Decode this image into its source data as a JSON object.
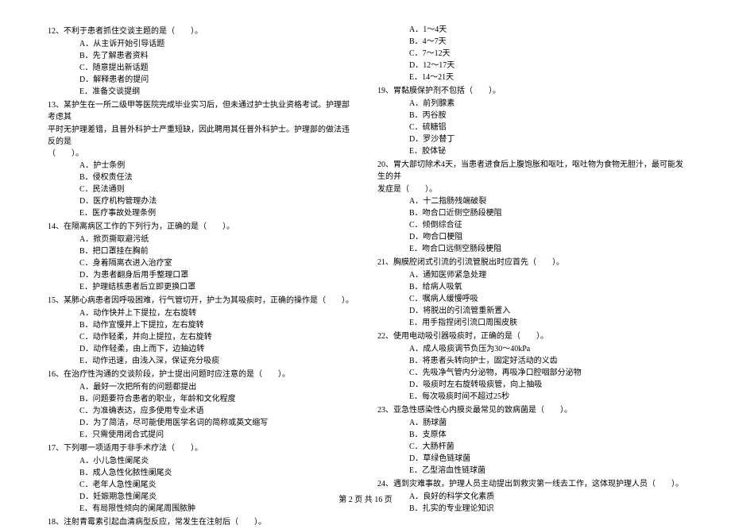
{
  "left": {
    "q12": {
      "stem": "12、不利于患者抓住交谈主题的是（　　）。",
      "A": "A．从主诉开始引导话题",
      "B": "B．先了解患者资料",
      "C": "C．随意提出新话题",
      "D": "D．解释患者的提问",
      "E": "E．准备交谈提纲"
    },
    "q13": {
      "stem1": "13、某护生在一所二级甲等医院完成毕业实习后，但未通过护士执业资格考试。护理部考虑其",
      "stem2": "平时无护理差错，且普外科护士严重短缺，因此聘用其任普外科护士。护理部的做法违反的是",
      "stem3": "（　　）。",
      "A": "A．护士条例",
      "B": "B．侵权责任法",
      "C": "C．民法通则",
      "D": "D．医疗机构管理办法",
      "E": "E．医疗事故处理条例"
    },
    "q14": {
      "stem": "14、在隔离病区工作的下列行为，正确的是（　　）。",
      "A": "A．掀页撕取避污纸",
      "B": "B．把口罩挂在胸前",
      "C": "C．身着隔离衣进入治疗室",
      "D": "D．为患者翻身后用手整理口罩",
      "E": "E．护理结核患者后立即更换口罩"
    },
    "q15": {
      "stem": "15、某肺心病患者因呼吸困难，行气管切开，护士为其吸痰时，正确的操作是（　　）。",
      "A": "A．动作快并上下提拉，左右旋转",
      "B": "B．动作宜慢并上下提拉，左右旋转",
      "C": "C．动作轻柔，并向上提拉，左右旋转",
      "D": "D．动作轻柔，由上而下，边抽边转",
      "E": "E．动作迅速，由浅入深，保证充分吸痰"
    },
    "q16": {
      "stem": "16、在治疗性沟通的交谈阶段，护士提出问题时应注意的是（　　）。",
      "A": "A．最好一次把所有的问题都提出",
      "B": "B．问题要符合患者的职业，年龄和文化程度",
      "C": "C．为准确表达，应多使用专业术语",
      "D": "D．为了简洁，尽可能使用医学名词的简称或英文缩写",
      "E": "E．只需使用闭合式提问"
    },
    "q17": {
      "stem": "17、下列哪一项适用于非手术疗法（　　）。",
      "A": "A．小儿急性阑尾炎",
      "B": "B．成人急性化脓性阑尾炎",
      "C": "C．老年人急性阑尾炎",
      "D": "D．妊娠期急性阑尾炎",
      "E": "E．有局限性倾向的阑尾周围脓肿"
    },
    "q18": {
      "stem": "18、注射青霉素引起血清病型反应，常发生在注射后（　　）。"
    }
  },
  "right": {
    "q18_options": {
      "A": "A．1～4天",
      "B": "B．4～7天",
      "C": "C．7～12天",
      "D": "D．12～17天",
      "E": "E．14～21天"
    },
    "q19": {
      "stem": "19、胃黏膜保护剂不包括（　　）。",
      "A": "A．前列腺素",
      "B": "B．丙谷胺",
      "C": "C．硫糖铝",
      "D": "D．罗沙替丁",
      "E": "E．胶体铋"
    },
    "q20": {
      "stem1": "20、胃大部切除术4天，当患者进食后上腹饱胀和呕吐，呕吐物为食物无胆汁，最可能发生的并",
      "stem2": "发症是（　　）。",
      "A": "A．十二指肠残端破裂",
      "B": "B．吻合口近侧空肠段梗阻",
      "C": "C．倾倒综合征",
      "D": "D．吻合口梗阻",
      "E": "E．吻合口远侧空肠段梗阻"
    },
    "q21": {
      "stem": "21、胸膜腔闭式引流的引流管脱出时应首先（　　）。",
      "A": "A．通知医师紧急处理",
      "B": "B．给病人吸氧",
      "C": "C．嘱病人缓慢呼吸",
      "D": "D．将脱出的引流管重新置入",
      "E": "E．用手指捏闭引流口周围皮肤"
    },
    "q22": {
      "stem": "22、使用电动吸引器吸痰时，正确的是（　　）。",
      "A": "A．成人吸痰调节负压为30～40kPa",
      "B": "B．将患者头转向护士，固定好活动的义齿",
      "C": "C．先吸净气管内分泌物，再吸净口腔咽部分泌物",
      "D": "D．吸痰时左右旋转吸痰管，向上抽吸",
      "E": "E．每次吸痰时间不超过25秒"
    },
    "q23": {
      "stem": "23、亚急性感染性心内膜炎最常见的致病菌是（　　）。",
      "A": "A．肠球菌",
      "B": "B．支原体",
      "C": "C．大肠杆菌",
      "D": "D．草绿色链球菌",
      "E": "E．乙型溶血性链球菌"
    },
    "q24": {
      "stem": "24、遇到灾难事故，护理人员主动提出到救灾第一线去工作，这体现护理人员（　　）。",
      "A": "A．良好的科学文化素质",
      "B": "B．扎实的专业理论知识"
    }
  },
  "footer": "第 2 页 共 16 页"
}
